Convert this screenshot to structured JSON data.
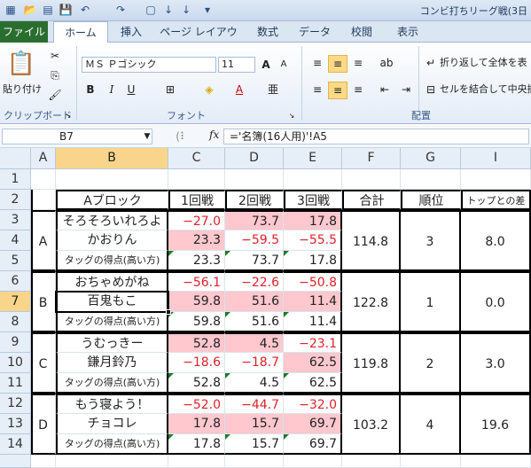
{
  "window": {
    "title": "コンビ打ちリーグ戦(3日"
  },
  "ribbon": {
    "tabs": [
      "ファイル",
      "ホーム",
      "挿入",
      "ページ レイアウト",
      "数式",
      "データ",
      "校閲",
      "表示"
    ],
    "paste_label": "貼り付け",
    "font_name": "ＭＳ Ｐゴシック",
    "font_size": "11",
    "wrap_text": "折り返して全体を表",
    "merge_center": "セルを結合して中央揃",
    "groups": {
      "clipboard": "クリップボード",
      "font": "フォント",
      "alignment": "配置"
    },
    "icons": {
      "bold": "B",
      "italic": "I",
      "underline": "U",
      "grow": "A",
      "shrink": "A"
    }
  },
  "formula_bar": {
    "name_box": "B7",
    "fx": "fx",
    "formula": "='名簿(16人用)'!A5"
  },
  "grid": {
    "columns": [
      "A",
      "B",
      "C",
      "D",
      "E",
      "F",
      "G",
      "I"
    ],
    "rows": [
      "1",
      "2",
      "3",
      "4",
      "5",
      "6",
      "7",
      "8",
      "9",
      "10",
      "11",
      "12",
      "13",
      "14"
    ],
    "header": {
      "block": "Aブロック",
      "r1": "1回戦",
      "r2": "2回戦",
      "r3": "3回戦",
      "total": "合計",
      "rank": "順位",
      "diff": "トップとの差"
    },
    "tag_label": "タッグの得点(高い方)",
    "blocks": [
      {
        "letter": "A",
        "players": [
          {
            "name": "そろそろいれろよ",
            "v": [
              "−27.0",
              "73.7",
              "17.8"
            ]
          },
          {
            "name": "かおりん",
            "v": [
              "23.3",
              "−59.5",
              "−55.5"
            ]
          }
        ],
        "tag": [
          "23.3",
          "73.7",
          "17.8"
        ],
        "total": "114.8",
        "rank": "3",
        "diff": "8.0"
      },
      {
        "letter": "B",
        "players": [
          {
            "name": "おちゃめがね",
            "v": [
              "−56.1",
              "−22.6",
              "−50.8"
            ]
          },
          {
            "name": "百鬼もこ",
            "v": [
              "59.8",
              "51.6",
              "11.4"
            ]
          }
        ],
        "tag": [
          "59.8",
          "51.6",
          "11.4"
        ],
        "total": "122.8",
        "rank": "1",
        "diff": "0.0"
      },
      {
        "letter": "C",
        "players": [
          {
            "name": "うむっきー",
            "v": [
              "52.8",
              "4.5",
              "−23.1"
            ]
          },
          {
            "name": "鎌月鈴乃",
            "v": [
              "−18.6",
              "−18.7",
              "62.5"
            ]
          }
        ],
        "tag": [
          "52.8",
          "4.5",
          "62.5"
        ],
        "total": "119.8",
        "rank": "2",
        "diff": "3.0"
      },
      {
        "letter": "D",
        "players": [
          {
            "name": "もう寝よう！",
            "v": [
              "−52.0",
              "−44.7",
              "−32.0"
            ]
          },
          {
            "name": "チョコレ",
            "v": [
              "17.8",
              "15.7",
              "69.7"
            ]
          }
        ],
        "tag": [
          "17.8",
          "15.7",
          "69.7"
        ],
        "total": "103.2",
        "rank": "4",
        "diff": "19.6"
      }
    ]
  }
}
